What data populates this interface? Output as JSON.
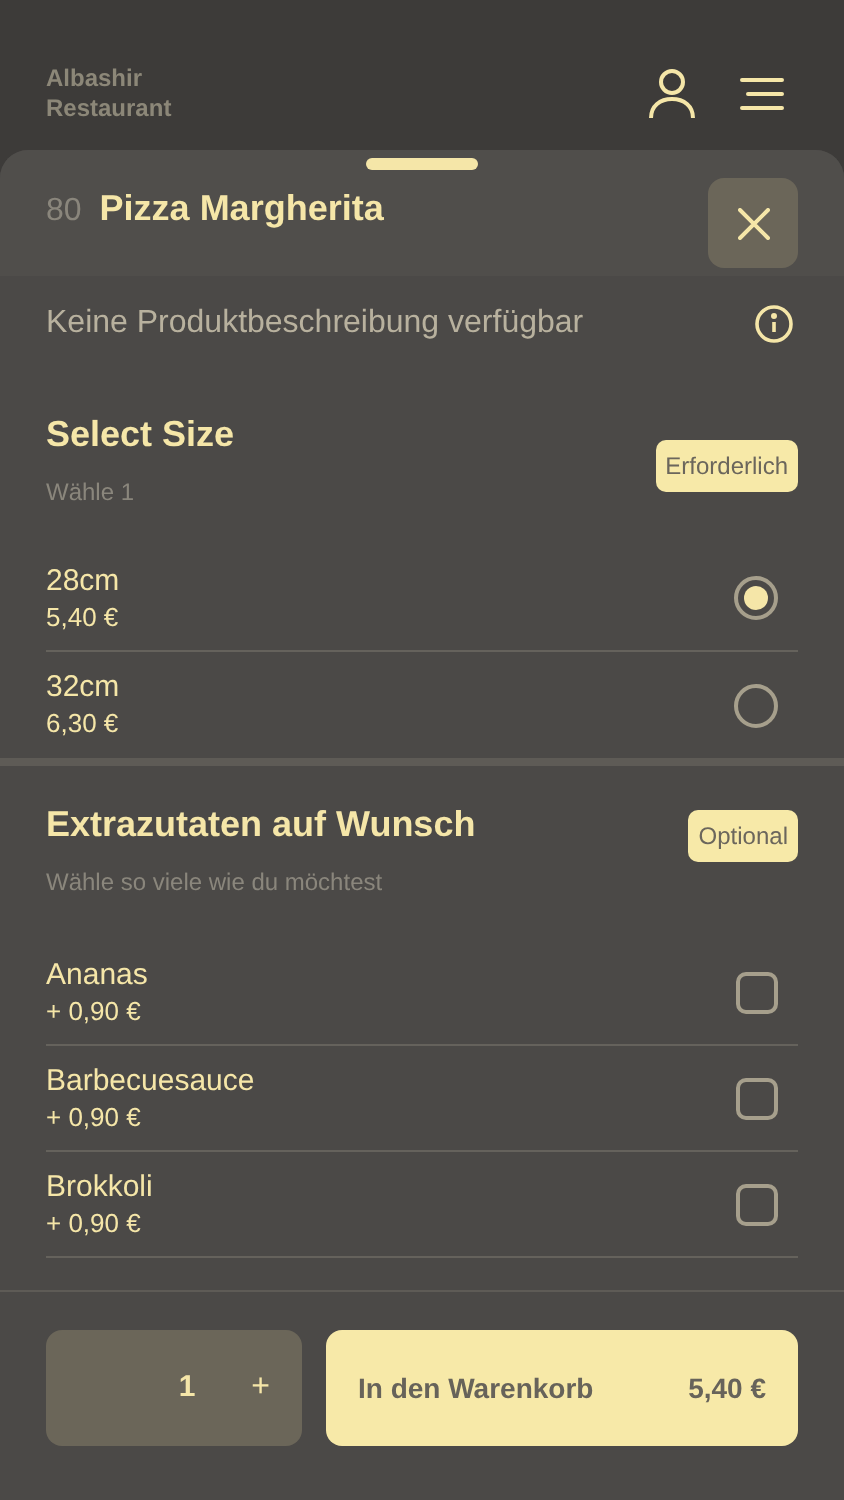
{
  "header": {
    "restaurant_name": "Albashir Restaurant"
  },
  "product": {
    "number": "80",
    "name": "Pizza Margherita",
    "description": "Keine Produktbeschreibung verfügbar"
  },
  "groups": [
    {
      "kind": "radio",
      "title": "Select Size",
      "subtitle": "Wähle 1",
      "badge": "Erforderlich",
      "options": [
        {
          "name": "28cm",
          "price": "5,40 €",
          "selected": true
        },
        {
          "name": "32cm",
          "price": "6,30 €",
          "selected": false
        }
      ]
    },
    {
      "kind": "checkbox",
      "title": "Extrazutaten auf Wunsch",
      "subtitle": "Wähle so viele wie du möchtest",
      "badge": "Optional",
      "options": [
        {
          "name": "Ananas",
          "price": "+ 0,90 €",
          "checked": false
        },
        {
          "name": "Barbecuesauce",
          "price": "+ 0,90 €",
          "checked": false
        },
        {
          "name": "Brokkoli",
          "price": "+ 0,90 €",
          "checked": false
        }
      ]
    }
  ],
  "footer": {
    "quantity": "1",
    "plus": "+",
    "add_label": "In den Warenkorb",
    "total": "5,40 €"
  }
}
